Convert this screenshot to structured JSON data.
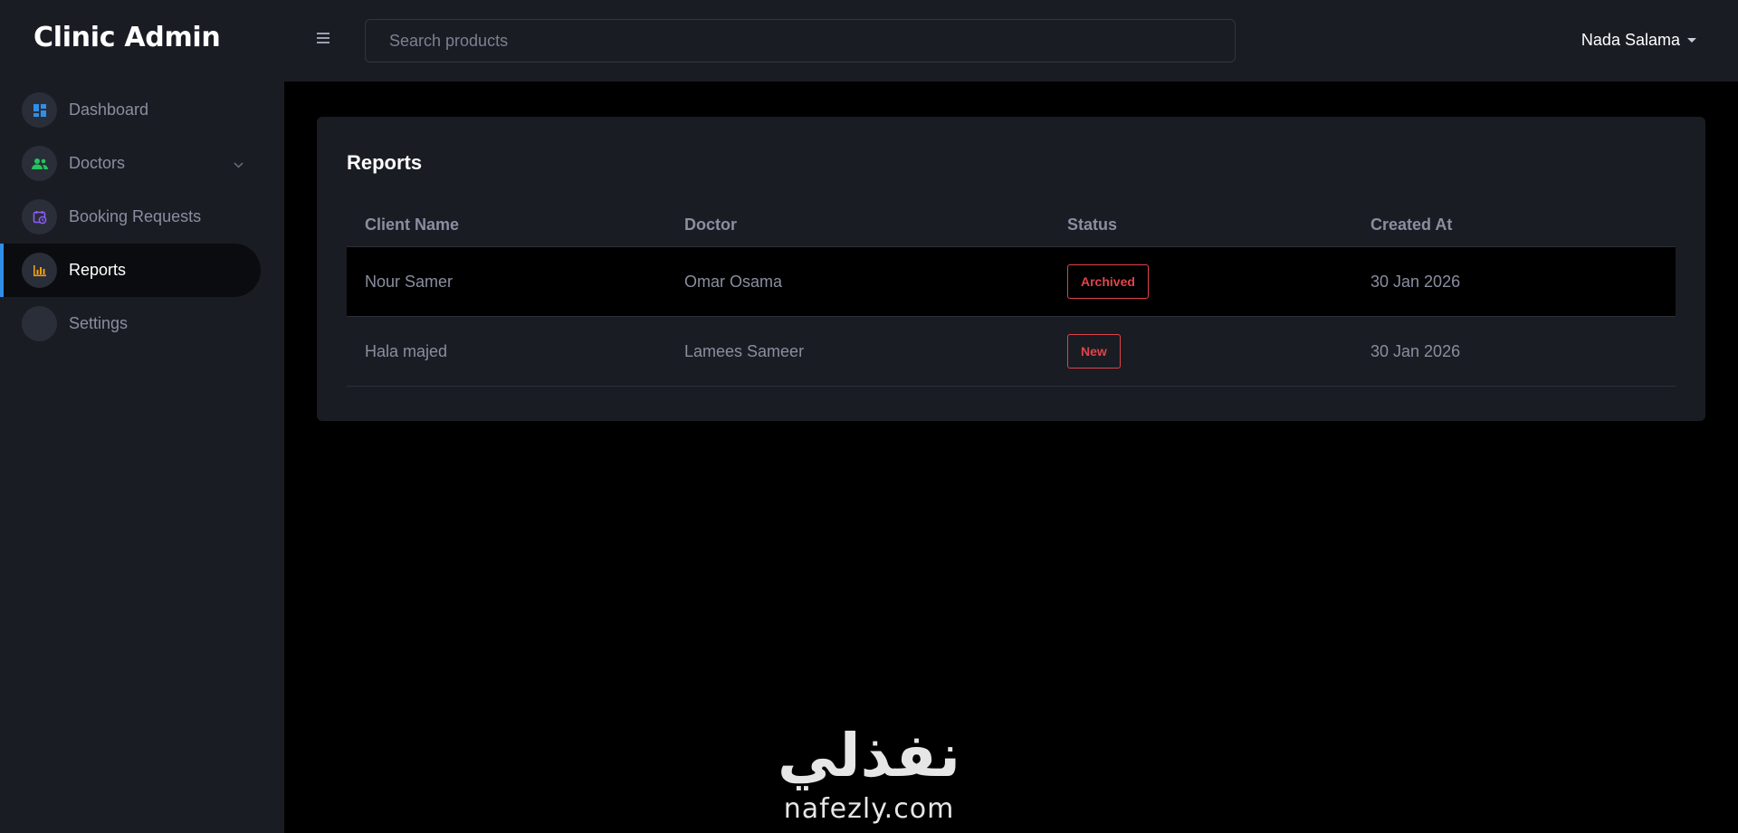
{
  "app": {
    "title": "Clinic Admin"
  },
  "sidebar": {
    "items": [
      {
        "label": "Dashboard",
        "icon": "dashboard-icon",
        "color": "#2f8ee8"
      },
      {
        "label": "Doctors",
        "icon": "users-icon",
        "color": "#22c55e"
      },
      {
        "label": "Booking Requests",
        "icon": "calendar-clock-icon",
        "color": "#8b5cf6"
      },
      {
        "label": "Reports",
        "icon": "bar-chart-icon",
        "color": "#f59e0b",
        "active": true
      },
      {
        "label": "Settings",
        "icon": "settings-icon"
      }
    ]
  },
  "header": {
    "search_placeholder": "Search products",
    "user_name": "Nada Salama"
  },
  "reports": {
    "title": "Reports",
    "columns": [
      "Client Name",
      "Doctor",
      "Status",
      "Created At"
    ],
    "rows": [
      {
        "client": "Nour Samer",
        "doctor": "Omar Osama",
        "status": "Archived",
        "created": "30 Jan 2026"
      },
      {
        "client": "Hala majed",
        "doctor": "Lamees Sameer",
        "status": "New",
        "created": "30 Jan 2026"
      }
    ]
  },
  "watermark": {
    "arabic": "نفذلي",
    "latin": "nafezly.com"
  },
  "colors": {
    "accent": "#2f8ee8",
    "status_badge": "#e0434a",
    "panel": "#1a1c23"
  }
}
